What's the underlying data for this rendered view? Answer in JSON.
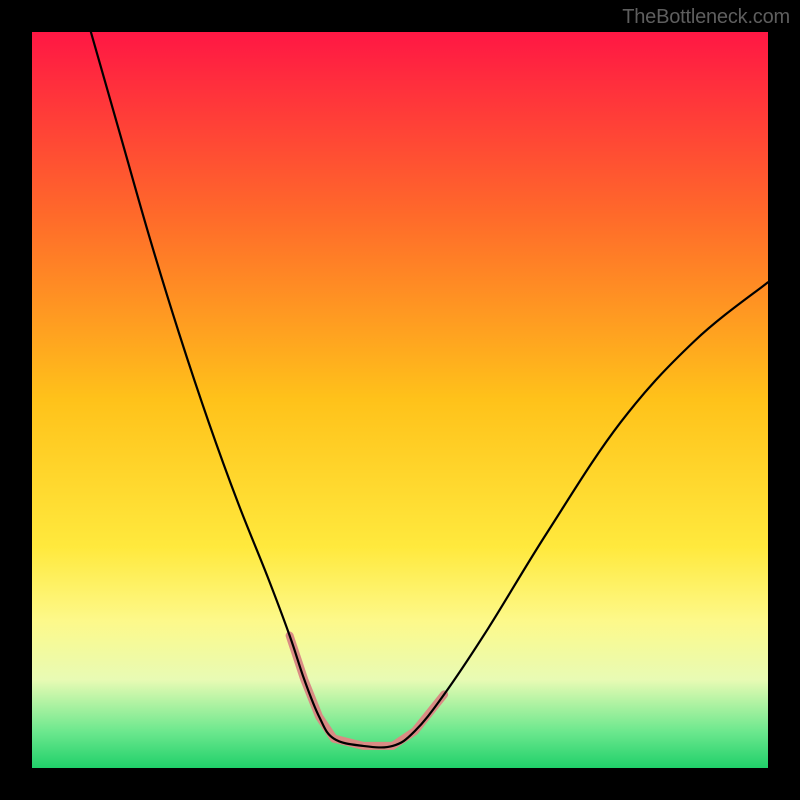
{
  "watermark": "TheBottleneck.com",
  "chart_data": {
    "type": "line",
    "title": "",
    "xlabel": "",
    "ylabel": "",
    "xlim": [
      0,
      100
    ],
    "ylim": [
      0,
      100
    ],
    "gradient_stops": [
      {
        "offset": 0,
        "color": "#ff1744"
      },
      {
        "offset": 0.25,
        "color": "#ff6a2a"
      },
      {
        "offset": 0.5,
        "color": "#ffc21a"
      },
      {
        "offset": 0.7,
        "color": "#ffe93d"
      },
      {
        "offset": 0.8,
        "color": "#fdf98a"
      },
      {
        "offset": 0.88,
        "color": "#e8fbb4"
      },
      {
        "offset": 0.95,
        "color": "#6de88e"
      },
      {
        "offset": 1.0,
        "color": "#20d06a"
      }
    ],
    "series": [
      {
        "name": "bottleneck-curve",
        "color": "#000000",
        "stroke_width": 2.2,
        "x": [
          8,
          12,
          16,
          20,
          24,
          28,
          32,
          35,
          37,
          39,
          41,
          45,
          49,
          52,
          56,
          62,
          70,
          80,
          90,
          100
        ],
        "y": [
          100,
          86,
          72,
          59,
          47,
          36,
          26,
          18,
          12,
          7,
          4,
          3,
          3,
          5,
          10,
          19,
          32,
          47,
          58,
          66
        ]
      }
    ],
    "markers": [
      {
        "name": "marker-segments",
        "color": "#d98b84",
        "stroke_width": 8,
        "segments": [
          {
            "x": [
              35,
              37,
              39,
              41
            ],
            "y": [
              18,
              12,
              7,
              4
            ]
          },
          {
            "x": [
              41,
              45,
              49
            ],
            "y": [
              4,
              3,
              3
            ]
          },
          {
            "x": [
              49,
              52,
              56
            ],
            "y": [
              3,
              5,
              10
            ]
          }
        ]
      }
    ]
  }
}
